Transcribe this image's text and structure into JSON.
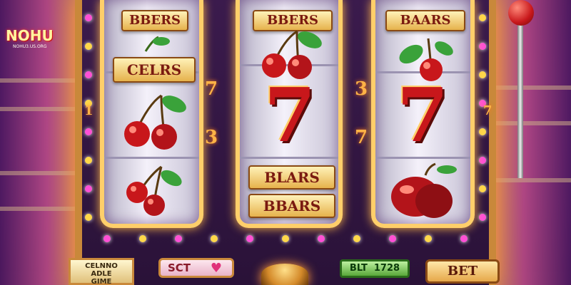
{
  "logo": {
    "brand": "NOHU",
    "domain": "NOHU3.US.ORG"
  },
  "reels": [
    {
      "sign_top": "BBERS",
      "sign_mid": "CELRS",
      "symbols": [
        "cherry-pair",
        "cherry-pair",
        "cherry-pair"
      ]
    },
    {
      "sign_top": "BBERS",
      "symbols": [
        "cherry-pair",
        "seven",
        "bar",
        "bar"
      ],
      "seven": "7",
      "bar_1": "BLARS",
      "bar_2": "BBARS"
    },
    {
      "sign_top": "BAARS",
      "symbols": [
        "cherry-pair",
        "seven",
        "plum"
      ],
      "seven": "7"
    }
  ],
  "side_numbers": {
    "left_top": "7",
    "left_bottom": "3",
    "right_top": "3",
    "right_bottom": "7",
    "left_small": "1",
    "right_small": "7"
  },
  "seven_glyph": "7",
  "controls": {
    "info_panel": "CELNNO\nADLE\nGIME",
    "select_button": "SCT",
    "bet_display": "BLT  1728",
    "bet_button": "BET"
  },
  "colors": {
    "gold": "#ffcf6a",
    "cherry_red": "#c8171b",
    "leaf_green": "#3aa23a",
    "glow": "#ff9a3c"
  }
}
